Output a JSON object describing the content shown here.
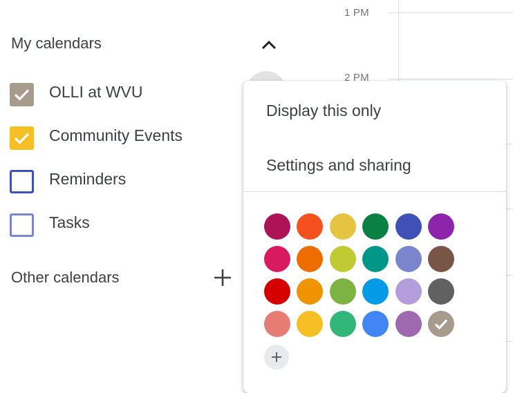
{
  "timegrid": {
    "labels": [
      "1 PM",
      "2 PM"
    ]
  },
  "sidebar": {
    "my_calendars_title": "My calendars",
    "other_calendars_title": "Other calendars",
    "collapse_icon": "chevron-up-icon",
    "add_icon": "plus-icon",
    "calendars": [
      {
        "label": "OLLI at WVU",
        "checked": true,
        "color": "#a79b8e"
      },
      {
        "label": "Community Events",
        "checked": true,
        "color": "#f6bf26"
      },
      {
        "label": "Reminders",
        "checked": false,
        "color": "#3f51b5"
      },
      {
        "label": "Tasks",
        "checked": false,
        "color": "#7986cb"
      }
    ]
  },
  "menu": {
    "items": [
      {
        "label": "Display this only"
      },
      {
        "label": "Settings and sharing"
      }
    ],
    "colors": [
      [
        "#ad1457",
        "#f4511e",
        "#e4c441",
        "#0b8043",
        "#3f51b5",
        "#8e24aa"
      ],
      [
        "#d81b60",
        "#ef6c00",
        "#c0ca33",
        "#009688",
        "#7986cb",
        "#795548"
      ],
      [
        "#d50000",
        "#f09300",
        "#7cb342",
        "#039be5",
        "#b39ddb",
        "#616161"
      ],
      [
        "#e67c73",
        "#f6bf26",
        "#33b679",
        "#4285f4",
        "#9e69af",
        "#a79b8e"
      ]
    ],
    "selected_color": "#a79b8e",
    "add_color_icon": "plus-icon"
  }
}
